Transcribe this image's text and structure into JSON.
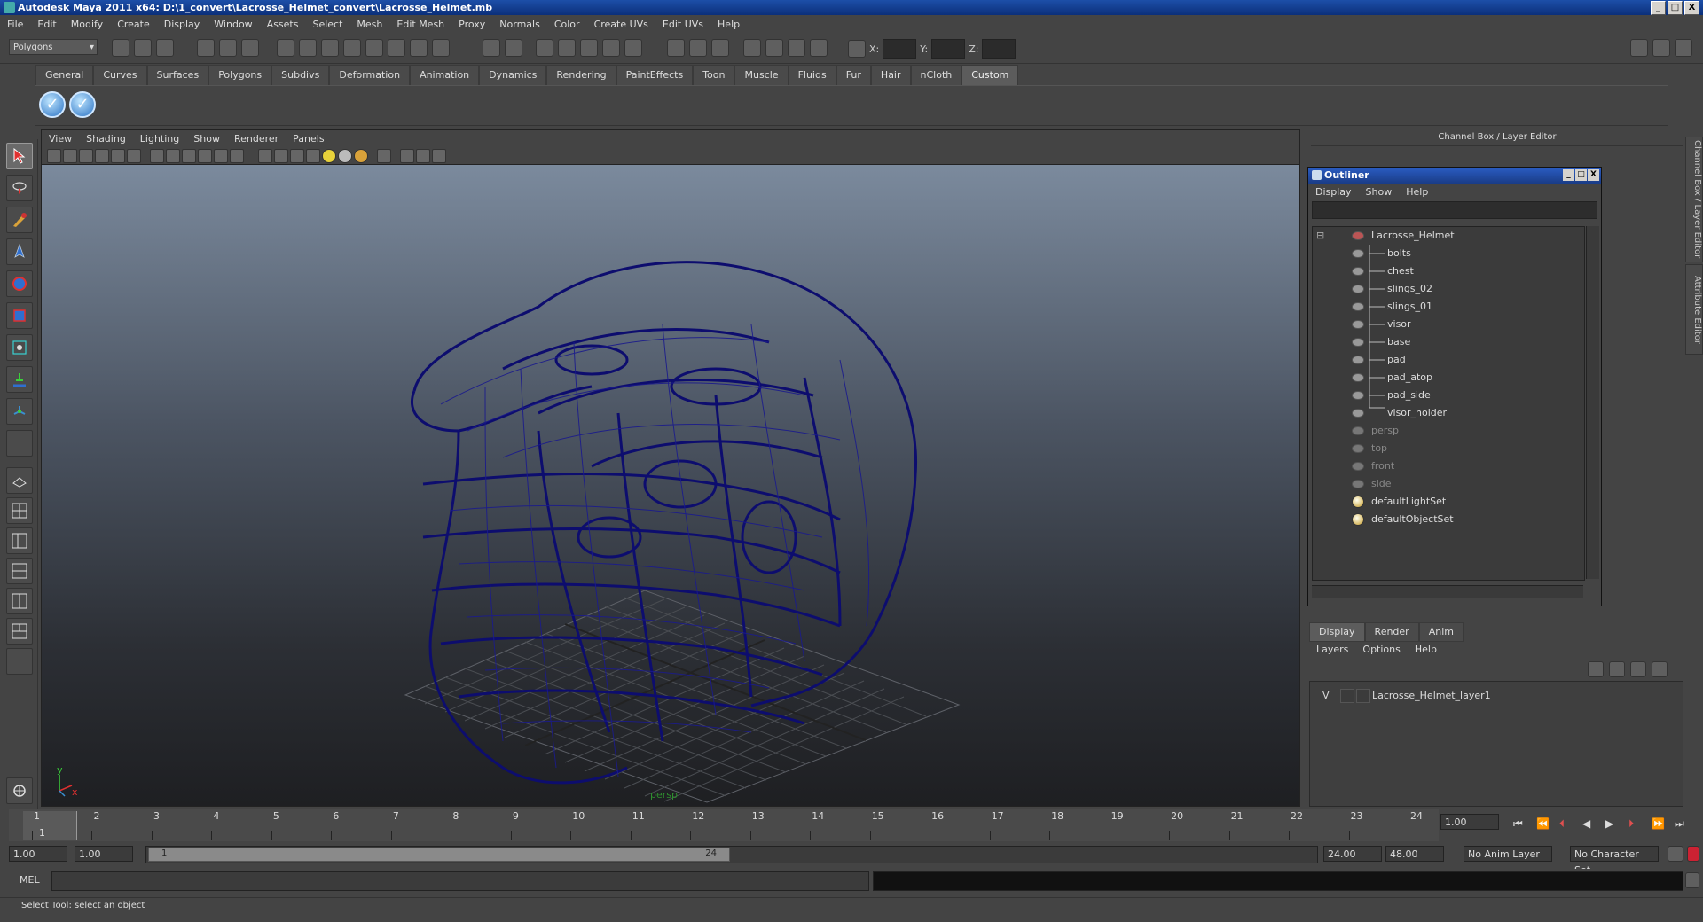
{
  "window": {
    "title": "Autodesk Maya 2011 x64: D:\\1_convert\\Lacrosse_Helmet_convert\\Lacrosse_Helmet.mb",
    "controls": [
      "_",
      "□",
      "X"
    ]
  },
  "menu": [
    "File",
    "Edit",
    "Modify",
    "Create",
    "Display",
    "Window",
    "Assets",
    "Select",
    "Mesh",
    "Edit Mesh",
    "Proxy",
    "Normals",
    "Color",
    "Create UVs",
    "Edit UVs",
    "Help"
  ],
  "statusline": {
    "mode": "Polygons",
    "x_label": "X:",
    "y_label": "Y:",
    "z_label": "Z:"
  },
  "shelf": {
    "tabs": [
      "General",
      "Curves",
      "Surfaces",
      "Polygons",
      "Subdivs",
      "Deformation",
      "Animation",
      "Dynamics",
      "Rendering",
      "PaintEffects",
      "Toon",
      "Muscle",
      "Fluids",
      "Fur",
      "Hair",
      "nCloth",
      "Custom"
    ],
    "active_tab": "Custom"
  },
  "viewport": {
    "menu": [
      "View",
      "Shading",
      "Lighting",
      "Show",
      "Renderer",
      "Panels"
    ],
    "camera_label": "persp",
    "axis_y": "y",
    "axis_x": "x"
  },
  "right_panel": {
    "header": "Channel Box / Layer Editor",
    "side_tabs": [
      "Channel Box / Layer Editor",
      "Attribute Editor"
    ]
  },
  "outliner": {
    "title": "Outliner",
    "menu": [
      "Display",
      "Show",
      "Help"
    ],
    "root": "Lacrosse_Helmet",
    "children": [
      "bolts",
      "chest",
      "slings_02",
      "slings_01",
      "visor",
      "base",
      "pad",
      "pad_atop",
      "pad_side",
      "visor_holder"
    ],
    "cameras": [
      "persp",
      "top",
      "front",
      "side"
    ],
    "sets": [
      "defaultLightSet",
      "defaultObjectSet"
    ]
  },
  "layer_editor": {
    "tabs": [
      "Display",
      "Render",
      "Anim"
    ],
    "menu": [
      "Layers",
      "Options",
      "Help"
    ],
    "layer_visible": "V",
    "layer_name": "Lacrosse_Helmet_layer1"
  },
  "timeline": {
    "ticks": [
      "1",
      "2",
      "3",
      "4",
      "5",
      "6",
      "7",
      "8",
      "9",
      "10",
      "11",
      "12",
      "13",
      "14",
      "15",
      "16",
      "17",
      "18",
      "19",
      "20",
      "21",
      "22",
      "23",
      "24"
    ],
    "current_frame_label": "1",
    "current_time": "1.00"
  },
  "range": {
    "start": "1.00",
    "playback_start": "1.00",
    "handle_left": "1",
    "handle_right": "24",
    "playback_end": "24.00",
    "end": "48.00",
    "anim_layer": "No Anim Layer",
    "character_set": "No Character Set"
  },
  "command": {
    "mel_label": "MEL"
  },
  "status": {
    "help_line": "Select Tool: select an object"
  }
}
